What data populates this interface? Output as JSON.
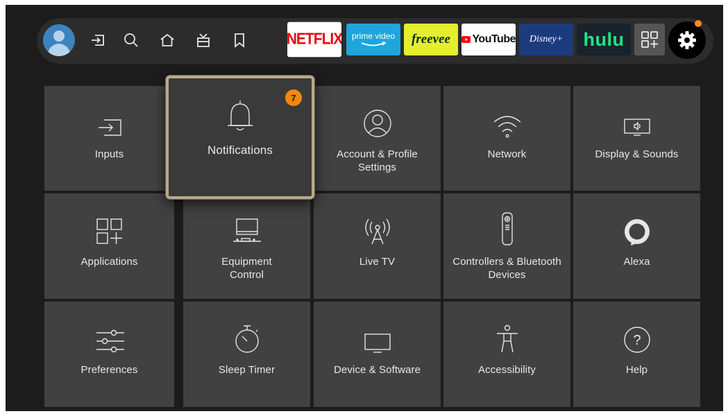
{
  "topbar": {
    "nav": [
      {
        "name": "inputs-nav-icon"
      },
      {
        "name": "search-icon"
      },
      {
        "name": "home-icon"
      },
      {
        "name": "live-tv-icon"
      },
      {
        "name": "watchlist-bookmark-icon"
      }
    ],
    "apps": [
      {
        "name": "netflix",
        "label": "NETFLIX"
      },
      {
        "name": "prime-video",
        "label": "prime video"
      },
      {
        "name": "freevee",
        "label": "freevee"
      },
      {
        "name": "youtube",
        "label": "YouTube"
      },
      {
        "name": "disney-plus",
        "label": "Disney+"
      },
      {
        "name": "hulu",
        "label": "hulu"
      }
    ],
    "settings_notification": true
  },
  "tiles": [
    {
      "label": "Inputs",
      "icon": "inputs-icon"
    },
    {
      "label": "Notifications",
      "icon": "bell-icon",
      "badge": "7",
      "focused": true
    },
    {
      "label": "Account & Profile Settings",
      "icon": "account-icon"
    },
    {
      "label": "Network",
      "icon": "wifi-icon"
    },
    {
      "label": "Display & Sounds",
      "icon": "display-sound-icon"
    },
    {
      "label": "Applications",
      "icon": "applications-icon"
    },
    {
      "label": "Equipment Control",
      "icon": "equipment-icon"
    },
    {
      "label": "Live TV",
      "icon": "antenna-icon"
    },
    {
      "label": "Controllers & Bluetooth Devices",
      "icon": "remote-icon"
    },
    {
      "label": "Alexa",
      "icon": "alexa-icon"
    },
    {
      "label": "Preferences",
      "icon": "sliders-icon"
    },
    {
      "label": "Sleep Timer",
      "icon": "stopwatch-icon"
    },
    {
      "label": "Device & Software",
      "icon": "tv-icon"
    },
    {
      "label": "Accessibility",
      "icon": "accessibility-icon"
    },
    {
      "label": "Help",
      "icon": "help-icon"
    }
  ],
  "colors": {
    "background": "#1c1c1c",
    "tile": "#414141",
    "focus_border": "#b8a98b",
    "badge": "#f1880a"
  }
}
